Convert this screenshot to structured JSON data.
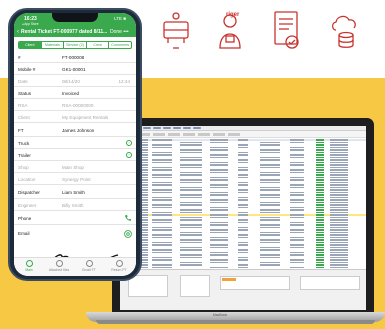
{
  "colors": {
    "accent_green": "#3aa84c",
    "brand_red": "#c8322d",
    "yellow_bg": "#f6c844"
  },
  "top_icons": [
    {
      "name": "dispatch-icon"
    },
    {
      "name": "engineer-icon",
      "label": "riger"
    },
    {
      "name": "document-check-icon"
    },
    {
      "name": "cloud-database-icon"
    }
  ],
  "phone": {
    "status_time": "16:23",
    "status_app": "◂ App Store",
    "status_right": "LTE ■",
    "nav": {
      "back": "‹",
      "title": "Rental Ticket FT-000977 dated 8/11...",
      "done": "Done •••"
    },
    "tabs": [
      {
        "label": "Client",
        "active": true
      },
      {
        "label": "Materials"
      },
      {
        "label": "Service (2)"
      },
      {
        "label": "Crew"
      },
      {
        "label": "Comments"
      }
    ],
    "rows": [
      {
        "label": "#",
        "value": "FT-000008"
      },
      {
        "label": "Mobile #",
        "value": "GK1-00001"
      },
      {
        "label": "Date",
        "value": "08/14/20",
        "right": "12:44",
        "muted": true
      },
      {
        "label": "Status",
        "value": "Invoiced"
      },
      {
        "label": "RSA",
        "value": "RSA-00000000",
        "muted": true
      },
      {
        "label": "Client",
        "value": "My Equipment Rentals",
        "muted": true
      },
      {
        "label": "FT",
        "value": "James Johnson"
      },
      {
        "label": "Truck",
        "value": "",
        "icon": true
      },
      {
        "label": "Trailer",
        "value": "",
        "icon": true
      },
      {
        "label": "Shop",
        "value": "Main Shop",
        "muted": true
      },
      {
        "label": "Location",
        "value": "Synergy Point",
        "muted": true
      },
      {
        "label": "Dispatcher",
        "value": "Liam Smith"
      },
      {
        "label": "Engineer",
        "value": "Billy Smith",
        "muted": true
      },
      {
        "label": "Phone",
        "value": "",
        "phone": true
      },
      {
        "label": "Email",
        "value": "",
        "email": true
      }
    ],
    "tabbar": [
      {
        "label": "Main",
        "active": true
      },
      {
        "label": "Attached files"
      },
      {
        "label": "Email FT"
      },
      {
        "label": "Return PT"
      }
    ]
  },
  "laptop": {
    "brand": "MacBook"
  }
}
